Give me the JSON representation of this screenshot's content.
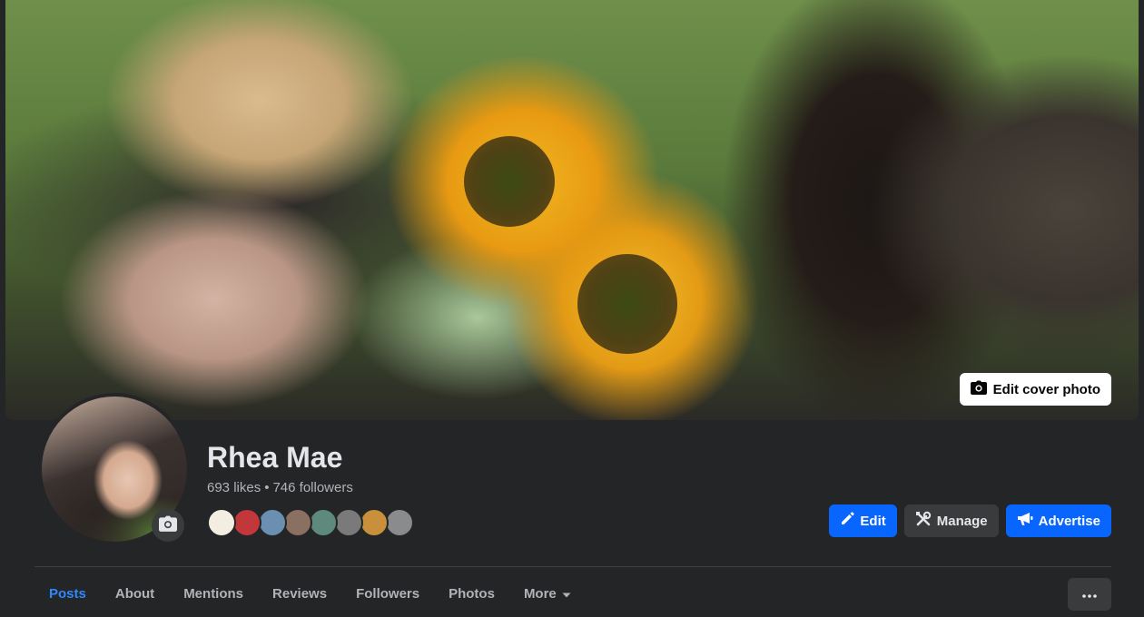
{
  "cover": {
    "edit_label": "Edit cover photo"
  },
  "profile": {
    "name": "Rhea Mae",
    "likes": "693 likes",
    "separator": "•",
    "followers": "746 followers",
    "friend_colors": [
      "#f4ede2",
      "#c2373a",
      "#6b8fb0",
      "#8a7060",
      "#5d8a7c",
      "#7a7a7a",
      "#c8903a",
      "#8a8b8d"
    ]
  },
  "actions": {
    "edit": "Edit",
    "manage": "Manage",
    "advertise": "Advertise"
  },
  "tabs": [
    {
      "label": "Posts"
    },
    {
      "label": "About"
    },
    {
      "label": "Mentions"
    },
    {
      "label": "Reviews"
    },
    {
      "label": "Followers"
    },
    {
      "label": "Photos"
    },
    {
      "label": "More"
    }
  ],
  "colors": {
    "accent": "#0866ff",
    "active_tab": "#2d88ff",
    "background": "#242526"
  }
}
